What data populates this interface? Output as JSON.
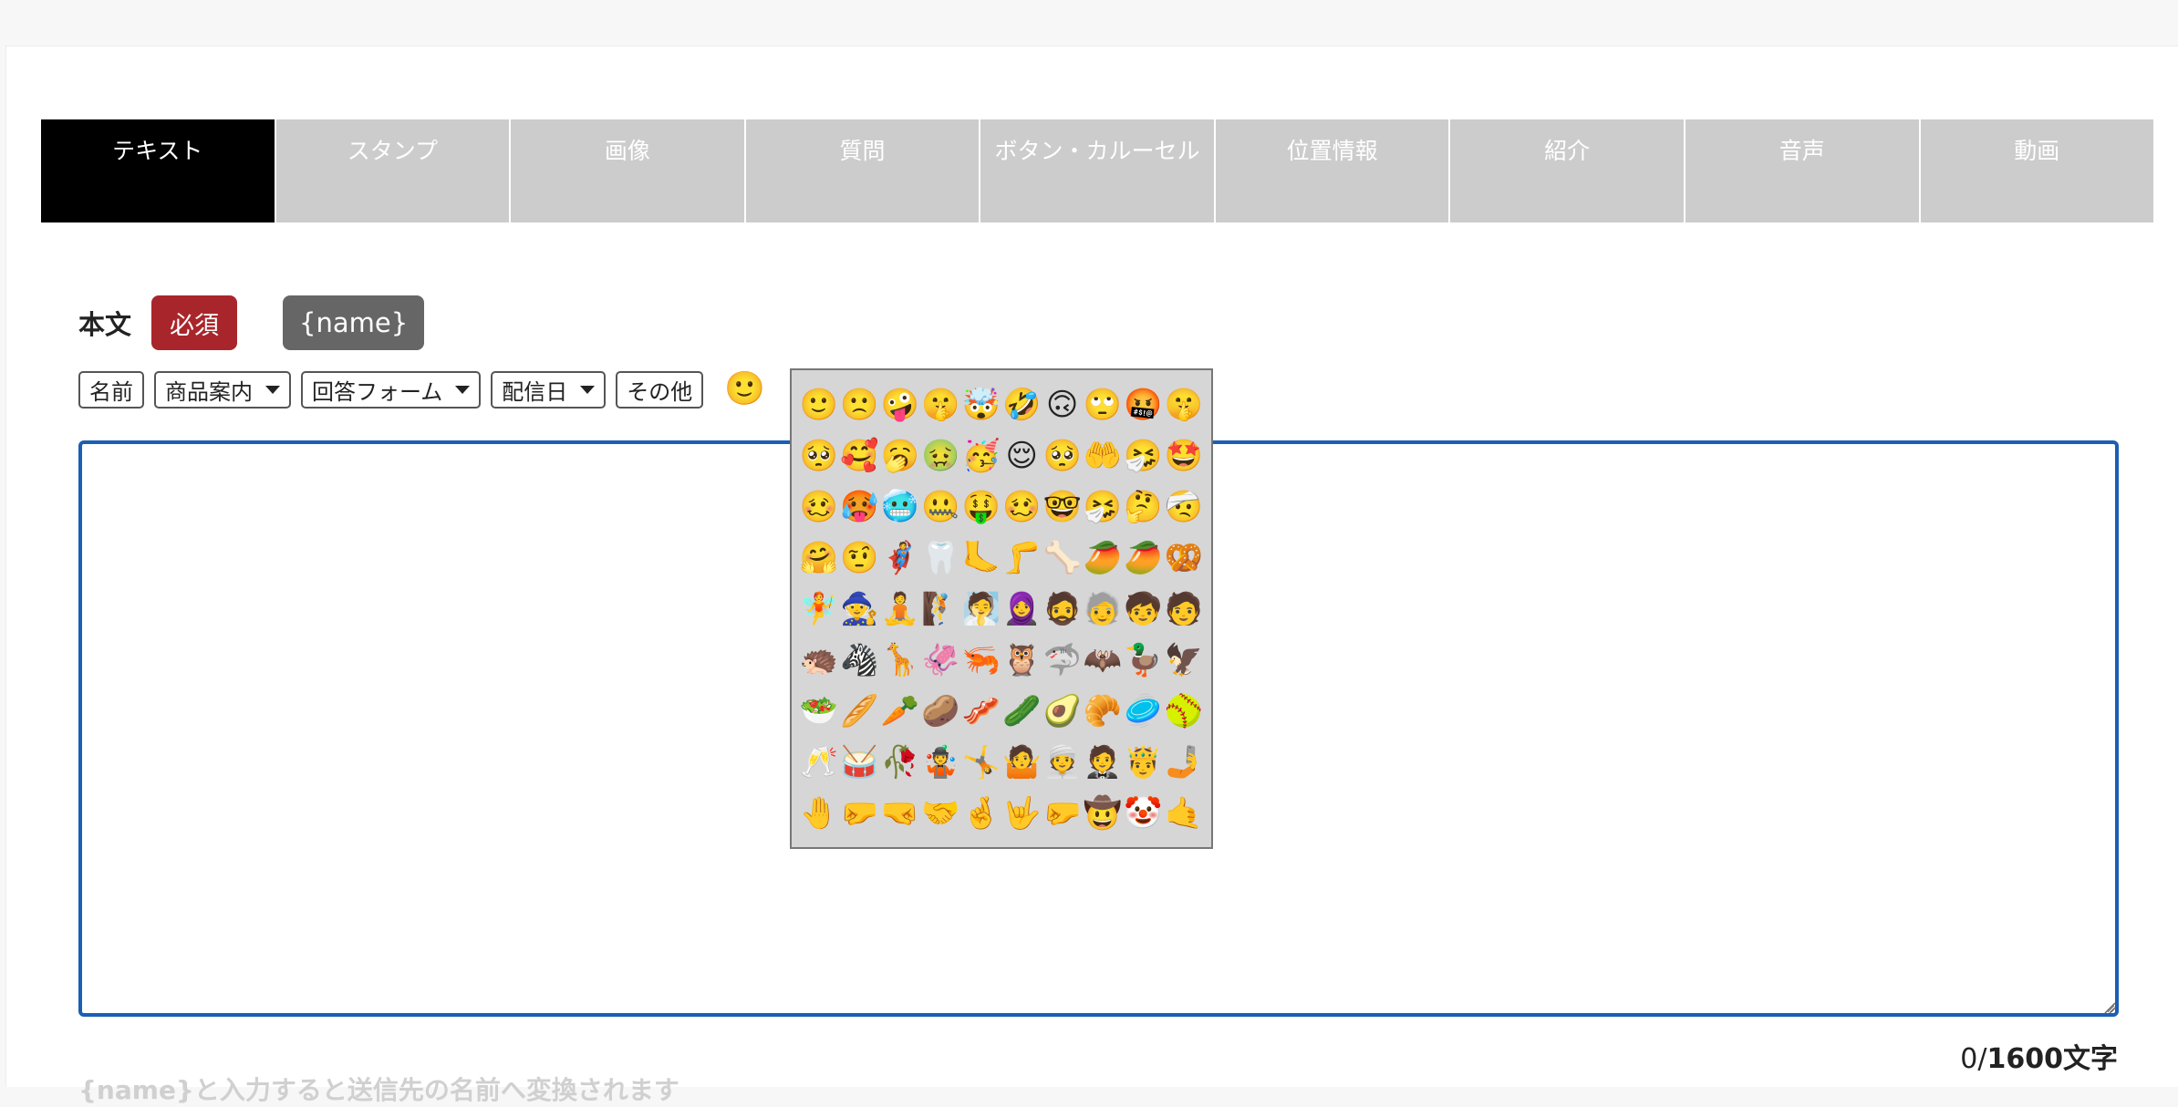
{
  "tabs": [
    {
      "label": "テキスト",
      "active": true
    },
    {
      "label": "スタンプ"
    },
    {
      "label": "画像"
    },
    {
      "label": "質問"
    },
    {
      "label": "ボタン・カルーセル"
    },
    {
      "label": "位置情報"
    },
    {
      "label": "紹介"
    },
    {
      "label": "音声"
    },
    {
      "label": "動画"
    }
  ],
  "body_label": "本文",
  "required_badge": "必須",
  "name_tag": "{name}",
  "toolbar": {
    "name_button": "名前",
    "product_dropdown": "商品案内",
    "answer_form_dropdown": "回答フォーム",
    "delivery_date_dropdown": "配信日",
    "other_button": "その他",
    "emoji_button": "🙂"
  },
  "emoji_picker": {
    "emojis": [
      "🙂",
      "🙁",
      "🤪",
      "🤫",
      "🤯",
      "🤣",
      "🙃",
      "🙄",
      "🤬",
      "🤫",
      "🥺",
      "🥰",
      "🥱",
      "🤢",
      "🥳",
      "😌",
      "🥺",
      "🤲",
      "🤧",
      "🤩",
      "🥴",
      "🥵",
      "🥶",
      "🤐",
      "🤑",
      "🥴",
      "🤓",
      "🤧",
      "🤔",
      "🤕",
      "🤗",
      "🤨",
      "🦸",
      "🦷",
      "🦶",
      "🦵",
      "🦴",
      "🥭",
      "🥭",
      "🥨",
      "🧚",
      "🧙",
      "🧘",
      "🧗",
      "🧖",
      "🧕",
      "🧔",
      "🧓",
      "🧒",
      "🧑",
      "🦔",
      "🦓",
      "🦒",
      "🦑",
      "🦐",
      "🦉",
      "🦈",
      "🦇",
      "🦆",
      "🦅",
      "🥗",
      "🥖",
      "🥕",
      "🥔",
      "🥓",
      "🥒",
      "🥑",
      "🥐",
      "🥏",
      "🥎",
      "🥂",
      "🥁",
      "🥀",
      "🤹",
      "🤸",
      "🤷",
      "👳",
      "🤵",
      "🤴",
      "🤳",
      "🤚",
      "🤛",
      "🤜",
      "🤝",
      "🤞",
      "🤟",
      "🤛",
      "🤠",
      "🤡",
      "🤙"
    ]
  },
  "textarea": {
    "value": ""
  },
  "counter": {
    "current": "0/",
    "max": "1600文字"
  },
  "hint": "{name}と入力すると送信先の名前へ変換されます"
}
